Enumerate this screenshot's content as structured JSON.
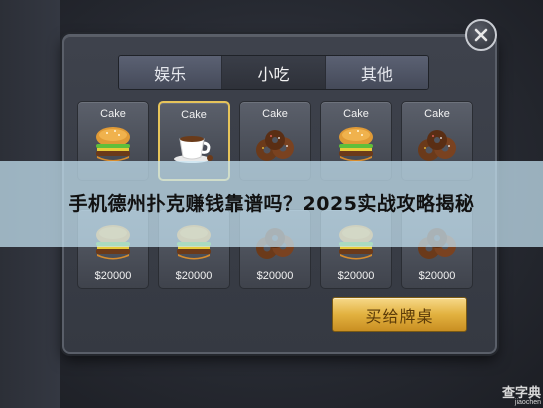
{
  "tabs": [
    {
      "label": "娱乐",
      "active": false
    },
    {
      "label": "小吃",
      "active": true
    },
    {
      "label": "其他",
      "active": false
    }
  ],
  "items": [
    {
      "label": "Cake",
      "icon": "burger-icon",
      "price": "",
      "selected": false
    },
    {
      "label": "Cake",
      "icon": "coffee-cup-icon",
      "price": "",
      "selected": true
    },
    {
      "label": "Cake",
      "icon": "donuts-icon",
      "price": "",
      "selected": false
    },
    {
      "label": "Cake",
      "icon": "burger-icon",
      "price": "",
      "selected": false
    },
    {
      "label": "Cake",
      "icon": "donuts-icon",
      "price": "",
      "selected": false
    },
    {
      "label": "",
      "icon": "burger-icon",
      "price": "$20000",
      "selected": false
    },
    {
      "label": "",
      "icon": "burger-icon",
      "price": "$20000",
      "selected": false
    },
    {
      "label": "",
      "icon": "donuts-icon",
      "price": "$20000",
      "selected": false
    },
    {
      "label": "",
      "icon": "burger-icon",
      "price": "$20000",
      "selected": false
    },
    {
      "label": "",
      "icon": "donuts-icon",
      "price": "$20000",
      "selected": false
    }
  ],
  "buy_button_label": "买给牌桌",
  "overlay_title": "手机德州扑克赚钱靠谱吗？2025实战攻略揭秘",
  "watermark": {
    "line1": "查字典",
    "line2": "jiaochen"
  },
  "colors": {
    "accent_gold": "#e6c45a",
    "button_gold": "#e2b13f",
    "overlay": "#c8e6f5"
  }
}
